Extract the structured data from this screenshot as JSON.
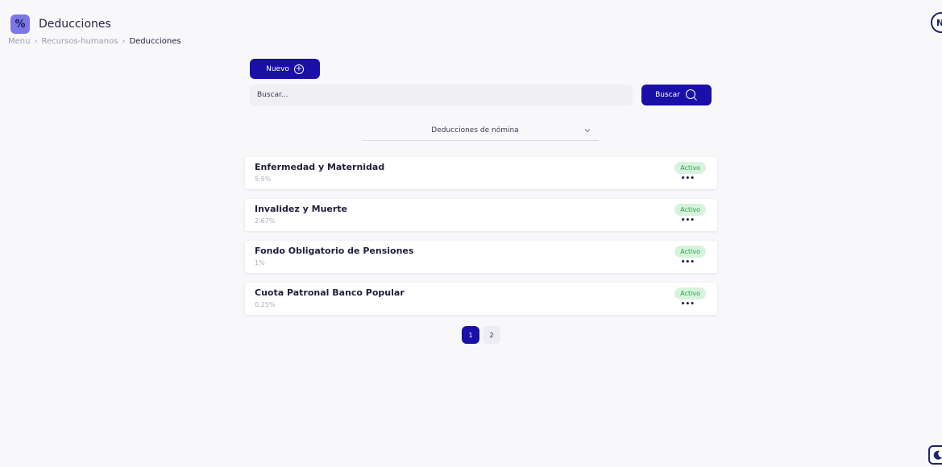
{
  "header": {
    "badge_symbol": "%",
    "title": "Deducciones"
  },
  "breadcrumb": {
    "items": [
      "Menu",
      "Recursos-humanos",
      "Deducciones"
    ],
    "separator": "›"
  },
  "avatar": {
    "initial": "N"
  },
  "toolbar": {
    "new_label": "Nuevo",
    "new_icon": "plus-circle-icon",
    "search_placeholder": "Buscar...",
    "search_label": "Buscar",
    "search_icon": "search-icon"
  },
  "filter": {
    "selected": "Deducciones de nómina"
  },
  "deductions": [
    {
      "name": "Enfermedad y Maternidad",
      "rate": "5.5%",
      "status": "Activo"
    },
    {
      "name": "Invalidez y Muerte",
      "rate": "2.67%",
      "status": "Activo"
    },
    {
      "name": "Fondo Obligatorio de Pensiones",
      "rate": "1%",
      "status": "Activo"
    },
    {
      "name": "Cuota Patronal Banco Popular",
      "rate": "0.25%",
      "status": "Activo"
    }
  ],
  "more_label": "•••",
  "pagination": {
    "pages": [
      "1",
      "2"
    ],
    "current": "1"
  },
  "colors": {
    "primary": "#1a0fa6",
    "badge_bg": "#d7f3dd",
    "badge_text": "#2aa14a",
    "header_badge": "#7b77e6"
  },
  "theme_toggle_icon": "moon-icon"
}
